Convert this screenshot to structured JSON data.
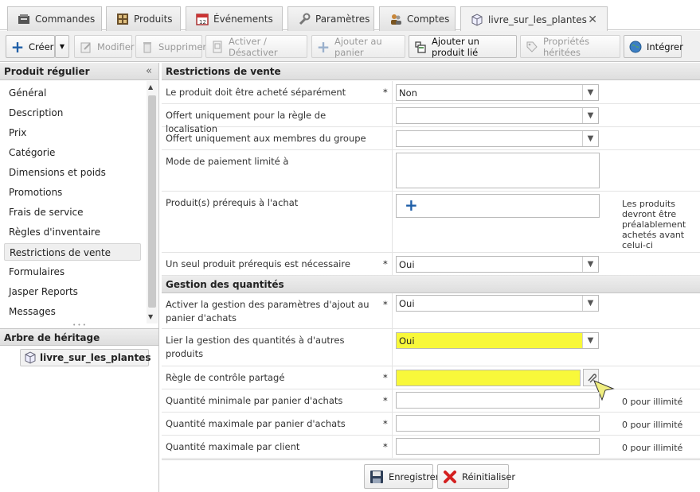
{
  "tabs": [
    {
      "label": "Commandes",
      "icon": "orders-icon"
    },
    {
      "label": "Produits",
      "icon": "products-icon"
    },
    {
      "label": "Événements",
      "icon": "calendar-icon"
    },
    {
      "label": "Paramètres",
      "icon": "wrench-icon"
    },
    {
      "label": "Comptes",
      "icon": "accounts-icon"
    },
    {
      "label": "livre_sur_les_plantes",
      "icon": "product-box-icon",
      "close": "✕"
    }
  ],
  "toolbar": {
    "create": "Créer",
    "modify": "Modifier",
    "delete": "Supprimer",
    "toggle": "Activer / Désactiver",
    "add_cart": "Ajouter au panier",
    "add_linked": "Ajouter un produit lié",
    "inherited": "Propriétés héritées",
    "integrate": "Intégrer"
  },
  "sidebar": {
    "title": "Produit régulier",
    "items": [
      "Général",
      "Description",
      "Prix",
      "Catégorie",
      "Dimensions et poids",
      "Promotions",
      "Frais de service",
      "Règles d'inventaire",
      "Restrictions de vente",
      "Formulaires",
      "Jasper Reports",
      "Messages"
    ],
    "selected_index": 8,
    "tree_title": "Arbre de héritage",
    "tree_node": "livre_sur_les_plantes"
  },
  "form": {
    "section1": "Restrictions de vente",
    "section2": "Gestion des quantités",
    "required_mark": "*",
    "rows": {
      "separately": {
        "label": "Le produit doit être acheté séparément",
        "value": "Non"
      },
      "localisation": {
        "label": "Offert uniquement pour la règle de localisation",
        "value": ""
      },
      "group": {
        "label": "Offert uniquement aux membres du groupe",
        "value": ""
      },
      "payment": {
        "label": "Mode de paiement limité à"
      },
      "prereq": {
        "label": "Produit(s) prérequis à l'achat",
        "hint": "Les produits devront être préalablement achetés avant celui-ci"
      },
      "one_prereq": {
        "label": "Un seul produit prérequis est nécessaire",
        "value": "Oui"
      },
      "activate_qty": {
        "label": "Activer la gestion des paramètres d'ajout au panier d'achats",
        "value": "Oui"
      },
      "link_qty": {
        "label": "Lier la gestion des quantités à d'autres produits",
        "value": "Oui"
      },
      "shared_rule": {
        "label": "Règle de contrôle partagé",
        "value": ""
      },
      "min_qty": {
        "label": "Quantité minimale par panier d'achats",
        "hint": "0 pour illimité"
      },
      "max_qty": {
        "label": "Quantité maximale par panier d'achats",
        "hint": "0 pour illimité"
      },
      "max_client": {
        "label": "Quantité maximale par client",
        "hint": "0 pour illimité"
      }
    }
  },
  "buttons": {
    "save": "Enregistrer",
    "reset": "Réinitialiser"
  },
  "colors": {
    "highlight": "#f8f83a",
    "accent_blue": "#1f5fa8",
    "reset_red": "#d42020"
  }
}
